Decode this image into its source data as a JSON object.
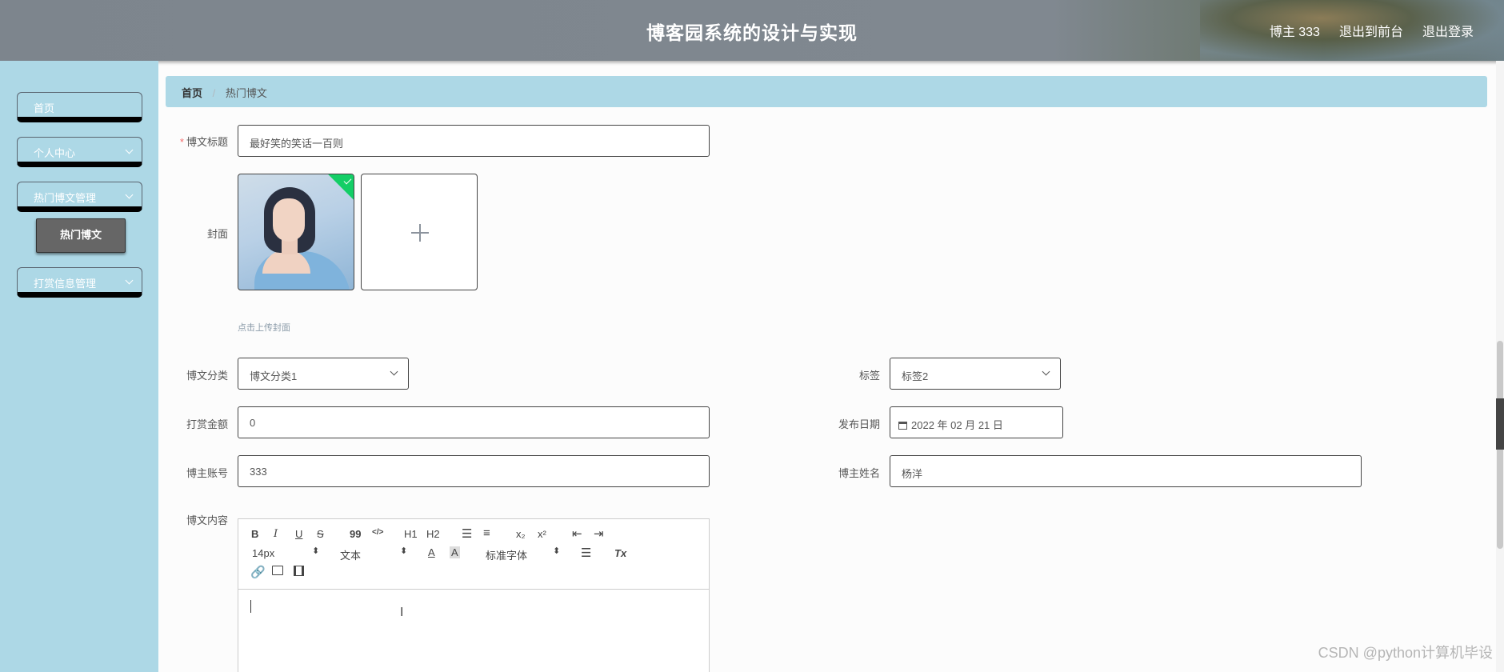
{
  "header": {
    "title": "博客园系统的设计与实现",
    "user_label": "博主 333",
    "back_front": "退出到前台",
    "logout": "退出登录"
  },
  "sidebar": {
    "items": [
      {
        "label": "首页"
      },
      {
        "label": "个人中心"
      },
      {
        "label": "热门博文管理"
      },
      {
        "label": "打赏信息管理"
      }
    ],
    "sub_item": "热门博文"
  },
  "breadcrumb": {
    "home": "首页",
    "sep": "/",
    "current": "热门博文"
  },
  "form": {
    "title_label": "博文标题",
    "title_value": "最好笑的笑话一百则",
    "cover_label": "封面",
    "cover_hint": "点击上传封面",
    "category_label": "博文分类",
    "category_value": "博文分类1",
    "tag_label": "标签",
    "tag_value": "标签2",
    "reward_label": "打赏金额",
    "reward_value": "0",
    "date_label": "发布日期",
    "date_value": "2022 年 02 月 21 日",
    "account_label": "博主账号",
    "account_value": "333",
    "name_label": "博主姓名",
    "name_value": "杨洋",
    "content_label": "博文内容"
  },
  "editor": {
    "bold": "B",
    "italic": "I",
    "underline": "U",
    "strike": "S",
    "quote": "99",
    "code": "</>",
    "h1": "H1",
    "h2": "H2",
    "sub": "x₂",
    "sup": "x²",
    "size": "14px",
    "format": "文本",
    "font": "标准字体",
    "clear": "Tx"
  },
  "watermark": "CSDN @python计算机毕设"
}
